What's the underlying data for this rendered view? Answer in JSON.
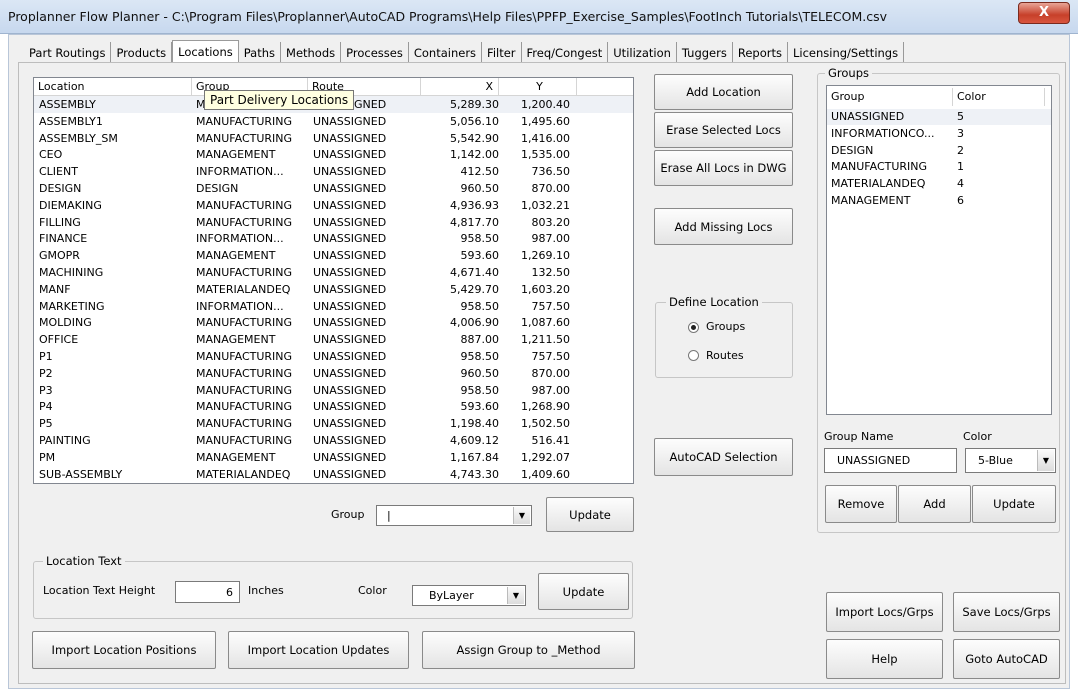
{
  "window": {
    "title": "Proplanner Flow Planner - C:\\Program Files\\Proplanner\\AutoCAD Programs\\Help Files\\PPFP_Exercise_Samples\\FootInch Tutorials\\TELECOM.csv",
    "close_glyph": "X"
  },
  "tabs": [
    {
      "label": "Part Routings"
    },
    {
      "label": "Products"
    },
    {
      "label": "Locations"
    },
    {
      "label": "Paths"
    },
    {
      "label": "Methods"
    },
    {
      "label": "Processes"
    },
    {
      "label": "Containers"
    },
    {
      "label": "Filter"
    },
    {
      "label": "Freq/Congest"
    },
    {
      "label": "Utilization"
    },
    {
      "label": "Tuggers"
    },
    {
      "label": "Reports"
    },
    {
      "label": "Licensing/Settings"
    }
  ],
  "locations_table": {
    "columns": [
      "Location",
      "Group",
      "Route",
      "X",
      "Y"
    ],
    "rows": [
      [
        "ASSEMBLY",
        "MANUFACTURING",
        "UNASSIGNED",
        "5,289.30",
        "1,200.40"
      ],
      [
        "ASSEMBLY1",
        "MANUFACTURING",
        "UNASSIGNED",
        "5,056.10",
        "1,495.60"
      ],
      [
        "ASSEMBLY_SM",
        "MANUFACTURING",
        "UNASSIGNED",
        "5,542.90",
        "1,416.00"
      ],
      [
        "CEO",
        "MANAGEMENT",
        "UNASSIGNED",
        "1,142.00",
        "1,535.00"
      ],
      [
        "CLIENT",
        "INFORMATION...",
        "UNASSIGNED",
        "412.50",
        "736.50"
      ],
      [
        "DESIGN",
        "DESIGN",
        "UNASSIGNED",
        "960.50",
        "870.00"
      ],
      [
        "DIEMAKING",
        "MANUFACTURING",
        "UNASSIGNED",
        "4,936.93",
        "1,032.21"
      ],
      [
        "FILLING",
        "MANUFACTURING",
        "UNASSIGNED",
        "4,817.70",
        "803.20"
      ],
      [
        "FINANCE",
        "INFORMATION...",
        "UNASSIGNED",
        "958.50",
        "987.00"
      ],
      [
        "GMOPR",
        "MANAGEMENT",
        "UNASSIGNED",
        "593.60",
        "1,269.10"
      ],
      [
        "MACHINING",
        "MANUFACTURING",
        "UNASSIGNED",
        "4,671.40",
        "132.50"
      ],
      [
        "MANF",
        "MATERIALANDEQ",
        "UNASSIGNED",
        "5,429.70",
        "1,603.20"
      ],
      [
        "MARKETING",
        "INFORMATION...",
        "UNASSIGNED",
        "958.50",
        "757.50"
      ],
      [
        "MOLDING",
        "MANUFACTURING",
        "UNASSIGNED",
        "4,006.90",
        "1,087.60"
      ],
      [
        "OFFICE",
        "MANAGEMENT",
        "UNASSIGNED",
        "887.00",
        "1,211.50"
      ],
      [
        "P1",
        "MANUFACTURING",
        "UNASSIGNED",
        "958.50",
        "757.50"
      ],
      [
        "P2",
        "MANUFACTURING",
        "UNASSIGNED",
        "960.50",
        "870.00"
      ],
      [
        "P3",
        "MANUFACTURING",
        "UNASSIGNED",
        "958.50",
        "987.00"
      ],
      [
        "P4",
        "MANUFACTURING",
        "UNASSIGNED",
        "593.60",
        "1,268.90"
      ],
      [
        "P5",
        "MANUFACTURING",
        "UNASSIGNED",
        "1,198.40",
        "1,502.50"
      ],
      [
        "PAINTING",
        "MANUFACTURING",
        "UNASSIGNED",
        "4,609.12",
        "516.41"
      ],
      [
        "PM",
        "MANAGEMENT",
        "UNASSIGNED",
        "1,167.84",
        "1,292.07"
      ],
      [
        "SUB-ASSEMBLY",
        "MATERIALANDEQ",
        "UNASSIGNED",
        "4,743.30",
        "1,409.60"
      ]
    ]
  },
  "tooltip": "Part Delivery Locations",
  "group_update": {
    "label": "Group",
    "value": "|",
    "update_label": "Update"
  },
  "location_text": {
    "frame_label": "Location Text",
    "height_label": "Location Text Height",
    "height_value": "6",
    "units": "Inches",
    "color_label": "Color",
    "color_value": "ByLayer",
    "update_label": "Update"
  },
  "bottom_buttons": {
    "import_positions": "Import Location Positions",
    "import_updates": "Import Location Updates",
    "assign_group": "Assign Group to _Method"
  },
  "middle_buttons": {
    "add_location": "Add Location",
    "erase_selected": "Erase Selected Locs",
    "erase_all": "Erase All Locs in DWG",
    "add_missing": "Add Missing Locs",
    "autocad_selection": "AutoCAD Selection"
  },
  "define_location": {
    "frame_label": "Define Location",
    "option_groups": "Groups",
    "option_routes": "Routes",
    "selected": "Groups"
  },
  "groups_panel": {
    "frame_label": "Groups",
    "columns": [
      "Group",
      "Color"
    ],
    "rows": [
      [
        "UNASSIGNED",
        "5"
      ],
      [
        "INFORMATIONCO...",
        "3"
      ],
      [
        "DESIGN",
        "2"
      ],
      [
        "MANUFACTURING",
        "1"
      ],
      [
        "MATERIALANDEQ",
        "4"
      ],
      [
        "MANAGEMENT",
        "6"
      ]
    ],
    "name_label": "Group Name",
    "color_label": "Color",
    "name_value": "UNASSIGNED",
    "color_value": "5-Blue",
    "remove_label": "Remove",
    "add_label": "Add",
    "update_label": "Update"
  },
  "right_buttons": {
    "import_locs": "Import Locs/Grps",
    "save_locs": "Save Locs/Grps",
    "help": "Help",
    "goto_autocad": "Goto AutoCAD"
  }
}
